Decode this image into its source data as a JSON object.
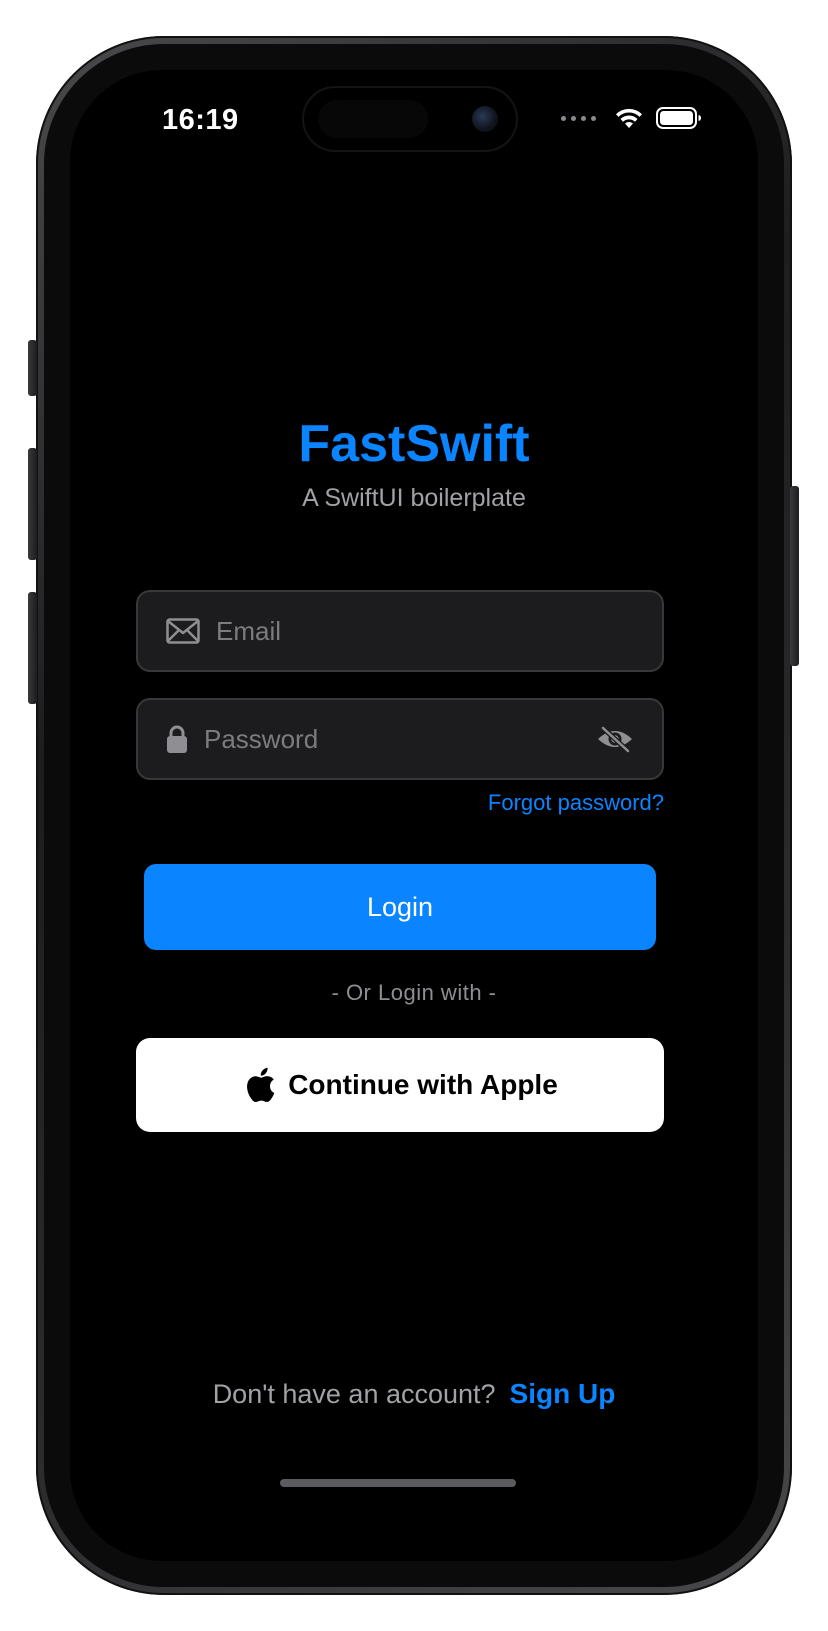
{
  "status_bar": {
    "time": "16:19"
  },
  "header": {
    "title": "FastSwift",
    "subtitle": "A SwiftUI boilerplate"
  },
  "form": {
    "email_placeholder": "Email",
    "password_placeholder": "Password",
    "forgot_password": "Forgot password?",
    "login_label": "Login"
  },
  "alt_login": {
    "divider_text": "- Or Login with -",
    "apple_label": "Continue with Apple"
  },
  "footer": {
    "signup_prompt": "Don't have an account?",
    "signup_link": "Sign Up"
  },
  "icons": {
    "email": "envelope-icon",
    "password": "lock-icon",
    "visibility": "eye-slash-icon",
    "apple": "apple-logo-icon",
    "wifi": "wifi-icon",
    "battery": "battery-icon",
    "cellular": "cellular-dots-icon"
  },
  "colors": {
    "accent": "#0a84ff",
    "background": "#000000",
    "field_background": "#1c1c1e",
    "field_border": "#38383a",
    "secondary_text": "#a1a1a6",
    "apple_button": "#ffffff"
  }
}
